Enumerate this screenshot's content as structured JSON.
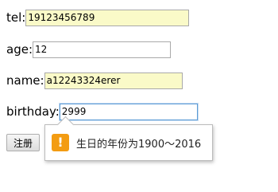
{
  "form": {
    "tel": {
      "label": "tel:",
      "value": "19123456789"
    },
    "age": {
      "label": "age:",
      "value": "12"
    },
    "name": {
      "label": "name:",
      "value": "a12243324erer"
    },
    "birthday": {
      "label": "birthday:",
      "value": "2999"
    },
    "submit_label": "注册"
  },
  "validation_tooltip": {
    "icon": "warning-icon",
    "icon_glyph": "!",
    "icon_color": "#f39c12",
    "message": "生日的年份为1900～2016"
  },
  "colors": {
    "autofill_background": "#fafac8",
    "focus_border": "#5b9bd5"
  }
}
